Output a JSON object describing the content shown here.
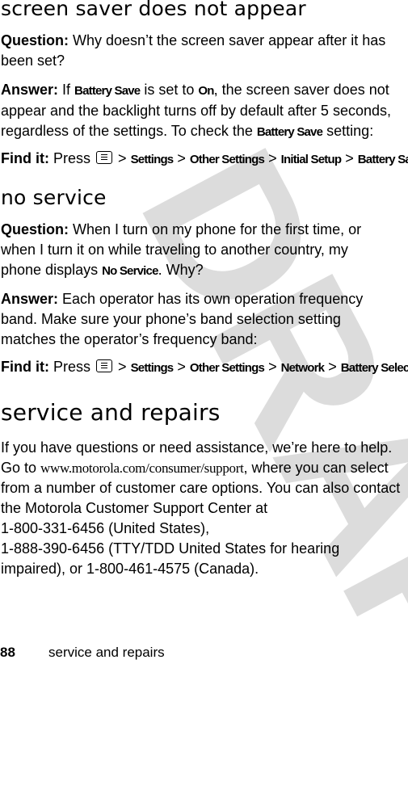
{
  "watermark": "DRAFT",
  "sections": [
    {
      "title": "screen saver does not appear",
      "question_label": "Question:",
      "question": "Why doesn’t the screen saver appear after it has been set?",
      "answer_label": "Answer:",
      "answer_parts": {
        "p1": "If ",
        "ui1": "Battery Save",
        "p2": " is set to ",
        "ui2": "On",
        "p3": ", the screen saver does not appear and the backlight turns off by default after 5 seconds, regardless of the settings. To check the ",
        "ui3": "Battery Save",
        "p4": " setting:"
      },
      "findit_label": "Find it:",
      "findit_press": "Press",
      "findit_icon": "menu-key-icon",
      "findit_path": [
        "Settings",
        "Other Settings",
        "Initial Setup",
        "Battery Save"
      ]
    },
    {
      "title": "no service",
      "question_label": "Question:",
      "question_parts": {
        "p1": "When I turn on my phone for the first time, or when I turn it on while traveling to another country, my phone displays ",
        "ui1": "No Service",
        "p2": ". Why?"
      },
      "answer_label": "Answer:",
      "answer": "Each operator has its own operation frequency band. Make sure your phone’s band selection setting matches the operator’s frequency band:",
      "findit_label": "Find it:",
      "findit_press": "Press",
      "findit_icon": "menu-key-icon",
      "findit_path": [
        "Settings",
        "Other Settings",
        "Network",
        "Battery Selection"
      ]
    },
    {
      "title": "service and repairs",
      "body_parts": {
        "p1": "If you have questions or need assistance, we’re here to help. Go to ",
        "url": "www.motorola.com/consumer/support",
        "p2": ", where you can select from a number of customer care options. You can also contact the Motorola Customer Support Center at",
        "line1": "1-800-331-6456 (United States),",
        "line2": "1-888-390-6456 (TTY/TDD United States for hearing impaired), or 1-800-461-4575 (Canada)."
      }
    }
  ],
  "footer": {
    "page_number": "88",
    "section": "service and repairs"
  },
  "separator": ">"
}
